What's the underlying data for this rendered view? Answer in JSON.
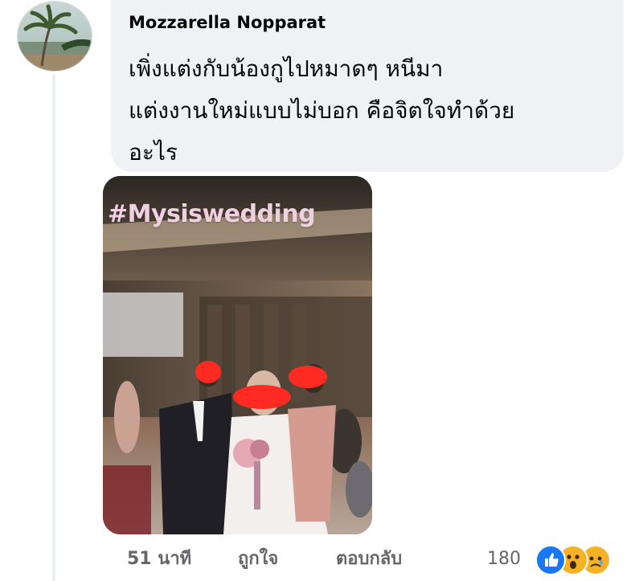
{
  "post": {
    "author": "Mozzarella Nopparat",
    "comment_text": "เพิ่งแต่งกับน้องกูไปหมาดๆ หนีมา\nแต่งงานใหม่แบบไม่บอก คือจิตใจทำด้วย\nอะไร",
    "photo_hashtag": "#Mysiswedding"
  },
  "actions": {
    "time": "51 นาที",
    "like": "ถูกใจ",
    "reply": "ตอบกลับ"
  },
  "reactions": {
    "count": "180",
    "types": [
      "like",
      "wow",
      "sad"
    ],
    "colors": {
      "like": "#1877f2",
      "wow": "#f7b125",
      "sad": "#f7b125"
    }
  }
}
